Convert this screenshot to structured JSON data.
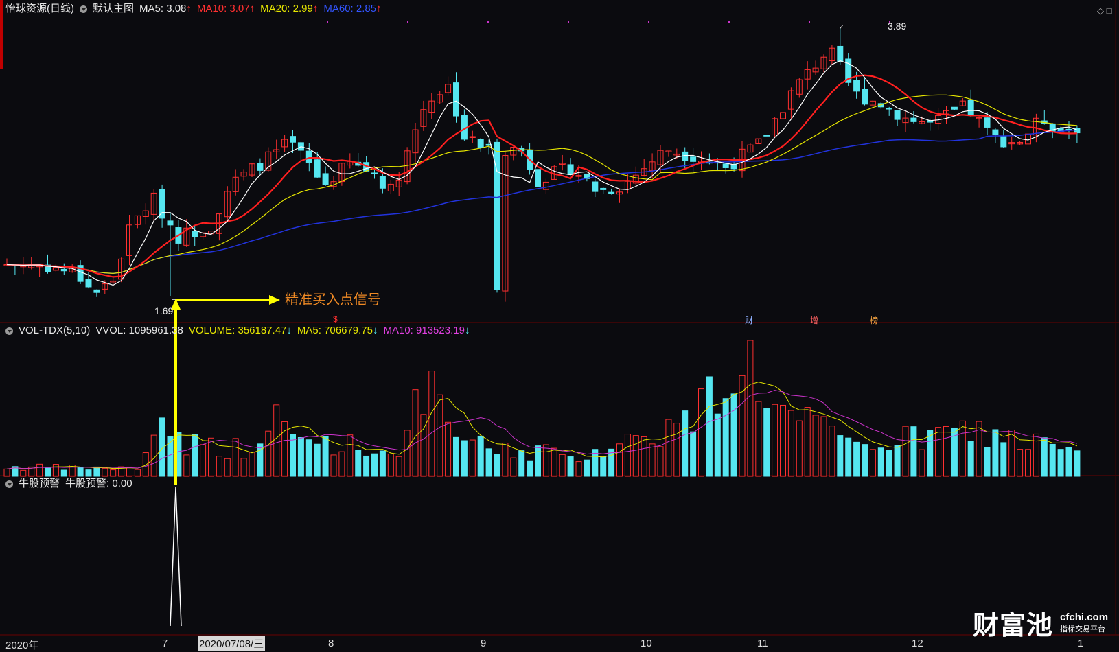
{
  "main_header": {
    "stock": "怡球资源(日线)",
    "template": "默认主图",
    "ma5": "MA5: 3.08",
    "ma10": "MA10: 3.07",
    "ma20": "MA20: 2.99",
    "ma60": "MA60: 2.85",
    "arrow_up": "↑"
  },
  "vol_header": {
    "name": "VOL-TDX(5,10)",
    "vvol": "VVOL: 1095961.38",
    "volume": "VOLUME: 356187.47",
    "ma5": "MA5: 706679.75",
    "ma10": "MA10: 913523.19",
    "arrow_down": "↓"
  },
  "ind_header": {
    "name": "牛股预警",
    "value": "牛股预警: 0.00"
  },
  "annotations": {
    "high_label": "3.89",
    "low_label": "1.69",
    "signal_text": "精准买入点信号",
    "markers": [
      "$",
      "财",
      "增",
      "榜"
    ]
  },
  "x_axis": {
    "year_label": "2020年",
    "months": [
      "7",
      "8",
      "9",
      "10",
      "11",
      "12",
      "1"
    ],
    "cursor_date": "2020/07/08/三"
  },
  "brand": {
    "cn": "财富池",
    "url": "cfchi.com",
    "tagline": "指标交易平台"
  },
  "colors": {
    "background": "#0b0b0f",
    "up": "#ff3030",
    "down": "#55e6f0",
    "ma5": "#ffffff",
    "ma10": "#ff2020",
    "ma20": "#e6e600",
    "ma60": "#2233dd",
    "vol_ma5": "#e6e600",
    "vol_ma10": "#cc33cc",
    "signal_arrow": "#ffff00",
    "signal_text": "#f08a24"
  },
  "chart_data": {
    "type": "candlestick",
    "price_anchors": [
      [
        0,
        1.95
      ],
      [
        20,
        1.95
      ],
      [
        40,
        1.88
      ],
      [
        52,
        1.72
      ],
      [
        62,
        1.82
      ],
      [
        72,
        2.25
      ],
      [
        85,
        2.5
      ],
      [
        100,
        2.18
      ],
      [
        120,
        2.28
      ],
      [
        130,
        2.6
      ],
      [
        150,
        2.8
      ],
      [
        165,
        2.95
      ],
      [
        175,
        2.8
      ],
      [
        185,
        2.6
      ],
      [
        200,
        2.78
      ],
      [
        215,
        2.7
      ],
      [
        225,
        2.55
      ],
      [
        245,
        3.3
      ],
      [
        258,
        3.42
      ],
      [
        267,
        3.0
      ],
      [
        280,
        2.9
      ],
      [
        300,
        2.9
      ],
      [
        310,
        2.65
      ],
      [
        330,
        2.75
      ],
      [
        345,
        2.55
      ],
      [
        360,
        2.6
      ],
      [
        385,
        2.9
      ],
      [
        400,
        2.85
      ],
      [
        420,
        2.75
      ],
      [
        440,
        2.95
      ],
      [
        460,
        3.4
      ],
      [
        480,
        3.72
      ],
      [
        495,
        3.35
      ],
      [
        510,
        3.28
      ],
      [
        525,
        3.15
      ],
      [
        540,
        3.1
      ],
      [
        560,
        3.25
      ],
      [
        575,
        3.0
      ],
      [
        590,
        2.95
      ],
      [
        605,
        3.15
      ],
      [
        615,
        3.05
      ],
      [
        625,
        3.08
      ]
    ],
    "volume_anchors": [
      [
        0,
        0.12
      ],
      [
        60,
        0.1
      ],
      [
        63,
        0.35
      ],
      [
        67,
        0.55
      ],
      [
        72,
        0.75
      ],
      [
        80,
        0.45
      ],
      [
        95,
        0.4
      ],
      [
        110,
        0.35
      ],
      [
        120,
        0.45
      ],
      [
        124,
        1.05
      ],
      [
        128,
        0.5
      ],
      [
        150,
        0.45
      ],
      [
        175,
        0.3
      ],
      [
        185,
        0.55
      ],
      [
        190,
        1.25
      ],
      [
        200,
        0.7
      ],
      [
        215,
        0.4
      ],
      [
        240,
        0.3
      ],
      [
        245,
        0.4
      ],
      [
        255,
        0.2
      ],
      [
        275,
        0.4
      ],
      [
        290,
        0.5
      ],
      [
        300,
        0.6
      ],
      [
        315,
        0.75
      ],
      [
        325,
        1.2
      ],
      [
        340,
        1.5
      ],
      [
        355,
        0.8
      ],
      [
        370,
        0.65
      ],
      [
        385,
        0.4
      ],
      [
        400,
        0.45
      ],
      [
        420,
        0.5
      ],
      [
        440,
        0.6
      ],
      [
        460,
        0.5
      ],
      [
        475,
        0.4
      ],
      [
        490,
        0.3
      ]
    ],
    "high": 3.89,
    "low": 1.69,
    "x_range_months": [
      "2020年",
      "7",
      "8",
      "9",
      "10",
      "11",
      "12",
      "1"
    ],
    "indicator_spike": {
      "date": "2020/07/08/三",
      "value": 1.0
    }
  }
}
